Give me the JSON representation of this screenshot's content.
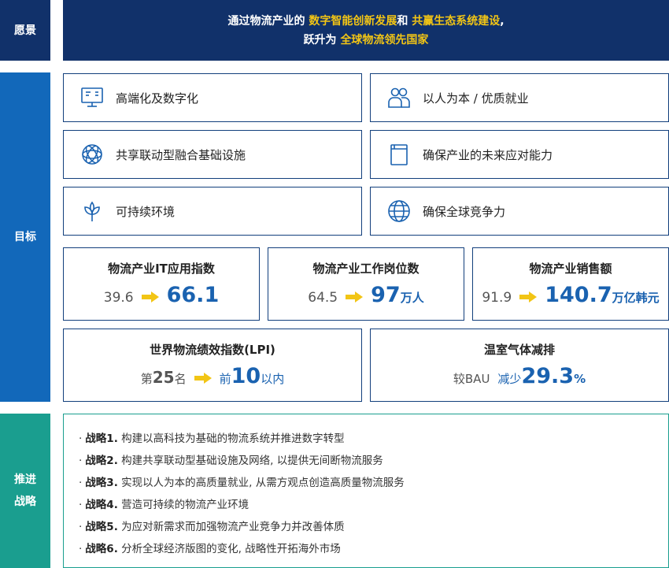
{
  "labels": {
    "vision": "愿景",
    "goals": "目标",
    "strategy_line1": "推进",
    "strategy_line2": "战略"
  },
  "vision": {
    "l1_a": "通过物流产业的 ",
    "l1_hl1": "数字智能创新发展",
    "l1_b": "和 ",
    "l1_hl2": "共赢生态系统建设",
    "l1_c": ",",
    "l2_a": "跃升为 ",
    "l2_hl": "全球物流领先国家"
  },
  "goals": [
    {
      "label": "高端化及数字化",
      "icon": "monitor-icon"
    },
    {
      "label": "以人为本 / 优质就业",
      "icon": "people-icon"
    },
    {
      "label": "共享联动型融合基础设施",
      "icon": "network-icon"
    },
    {
      "label": "确保产业的未来应对能力",
      "icon": "book-icon"
    },
    {
      "label": "可持续环境",
      "icon": "sprout-icon"
    },
    {
      "label": "确保全球竞争力",
      "icon": "globe-icon"
    }
  ],
  "kpis": [
    {
      "title": "物流产业IT应用指数",
      "old": "39.6",
      "new": "66.1",
      "unit": ""
    },
    {
      "title": "物流产业工作岗位数",
      "old": "64.5",
      "new": "97",
      "unit": "万人"
    },
    {
      "title": "物流产业销售额",
      "old": "91.9",
      "new": "140.7",
      "unit": "万亿韩元"
    }
  ],
  "kpi_lpi": {
    "title": "世界物流绩效指数(LPI)",
    "old_pre": "第",
    "old_num": "25",
    "old_post": "名",
    "new_pre": "前",
    "new_num": "10",
    "new_post": "以内"
  },
  "kpi_ghg": {
    "title": "温室气体减排",
    "pre": "较BAU",
    "mid": "减少",
    "num": "29.3",
    "unit": "%"
  },
  "strategies": [
    {
      "name": "战略1.",
      "text": "构建以高科技为基础的物流系统并推进数字转型"
    },
    {
      "name": "战略2.",
      "text": "构建共享联动型基础设施及网络, 以提供无间断物流服务"
    },
    {
      "name": "战略3.",
      "text": "实现以人为本的高质量就业, 从需方观点创造高质量物流服务"
    },
    {
      "name": "战略4.",
      "text": "营造可持续的物流产业环境"
    },
    {
      "name": "战略5.",
      "text": "为应对新需求而加强物流产业竞争力并改善体质"
    },
    {
      "name": "战略6.",
      "text": "分析全球经济版图的变化, 战略性开拓海外市场"
    }
  ],
  "bullet": "·",
  "colors": {
    "navy": "#11316a",
    "blue": "#1268ba",
    "teal": "#1a9e8f",
    "highlight": "#f2c515",
    "arrow": "#f2c515",
    "number": "#1a62b0"
  }
}
